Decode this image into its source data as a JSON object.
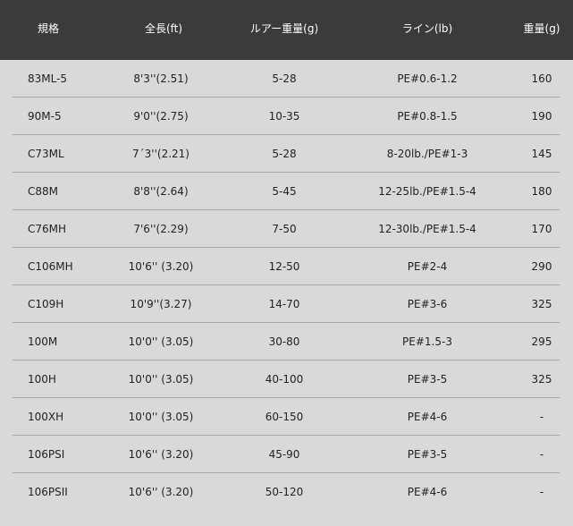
{
  "table": {
    "headers": {
      "model": "規格",
      "length": "全長(ft)",
      "lure_weight": "ルアー重量(g)",
      "line": "ライン(lb)",
      "weight": "重量(g)"
    },
    "rows": [
      {
        "model": "83ML-5",
        "length": "8'3''(2.51)",
        "lure_weight": "5-28",
        "line": "PE#0.6-1.2",
        "weight": "160"
      },
      {
        "model": "90M-5",
        "length": "9'0''(2.75)",
        "lure_weight": "10-35",
        "line": "PE#0.8-1.5",
        "weight": "190"
      },
      {
        "model": "C73ML",
        "length": "7´3''(2.21)",
        "lure_weight": "5-28",
        "line": "8-20lb./PE#1-3",
        "weight": "145"
      },
      {
        "model": "C88M",
        "length": "8'8''(2.64)",
        "lure_weight": "5-45",
        "line": "12-25lb./PE#1.5-4",
        "weight": "180"
      },
      {
        "model": "C76MH",
        "length": "7'6''(2.29)",
        "lure_weight": "7-50",
        "line": "12-30lb./PE#1.5-4",
        "weight": "170"
      },
      {
        "model": "C106MH",
        "length": "10'6'' (3.20)",
        "lure_weight": "12-50",
        "line": "PE#2-4",
        "weight": "290"
      },
      {
        "model": "C109H",
        "length": "10'9''(3.27)",
        "lure_weight": "14-70",
        "line": "PE#3-6",
        "weight": "325"
      },
      {
        "model": "100M",
        "length": "10'0'' (3.05)",
        "lure_weight": "30-80",
        "line": "PE#1.5-3",
        "weight": "295"
      },
      {
        "model": "100H",
        "length": "10'0'' (3.05)",
        "lure_weight": "40-100",
        "line": "PE#3-5",
        "weight": "325"
      },
      {
        "model": "100XH",
        "length": "10'0'' (3.05)",
        "lure_weight": "60-150",
        "line": "PE#4-6",
        "weight": "-"
      },
      {
        "model": "106PSI",
        "length": "10'6'' (3.20)",
        "lure_weight": "45-90",
        "line": "PE#3-5",
        "weight": "-"
      },
      {
        "model": "106PSII",
        "length": "10'6'' (3.20)",
        "lure_weight": "50-120",
        "line": "PE#4-6",
        "weight": "-"
      }
    ]
  },
  "colors": {
    "header_background": "#3b3b3b",
    "header_text": "#ffffff",
    "body_background": "#d9d9d9",
    "row_divider": "#a7a7a7",
    "body_text": "#222222"
  }
}
